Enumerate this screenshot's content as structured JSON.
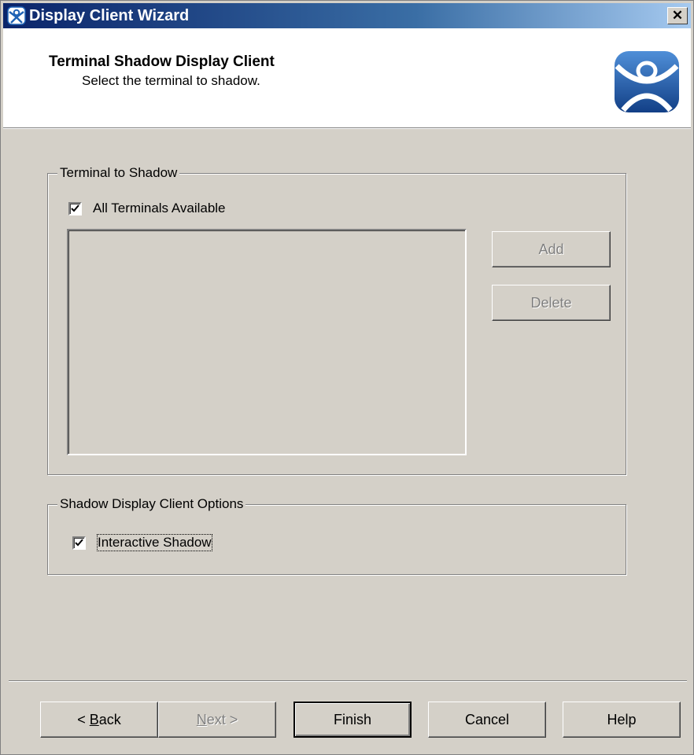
{
  "window": {
    "title": "Display Client Wizard",
    "close_label": "✕"
  },
  "header": {
    "title": "Terminal Shadow Display Client",
    "subtitle": "Select the terminal to shadow."
  },
  "terminal_group": {
    "label": "Terminal to Shadow",
    "all_terminals": {
      "label": "All Terminals Available",
      "checked": true
    },
    "terminals_list": [],
    "add_label": "Add",
    "delete_label": "Delete"
  },
  "options_group": {
    "label": "Shadow Display Client Options",
    "interactive_shadow": {
      "label": "Interactive Shadow",
      "checked": true
    }
  },
  "footer": {
    "back_label": "< Back",
    "back_mnemonic": "B",
    "next_label": "Next >",
    "next_mnemonic": "N",
    "finish_label": "Finish",
    "cancel_label": "Cancel",
    "help_label": "Help"
  },
  "colors": {
    "dialog_bg": "#d4d0c8",
    "titlebar_start": "#0a246a",
    "titlebar_end": "#a6caf0",
    "logo_blue": "#1f63b5"
  },
  "icons": {
    "app": "thinmanager-icon",
    "header_logo": "thinmanager-logo",
    "close": "close-icon",
    "check": "check-icon"
  }
}
